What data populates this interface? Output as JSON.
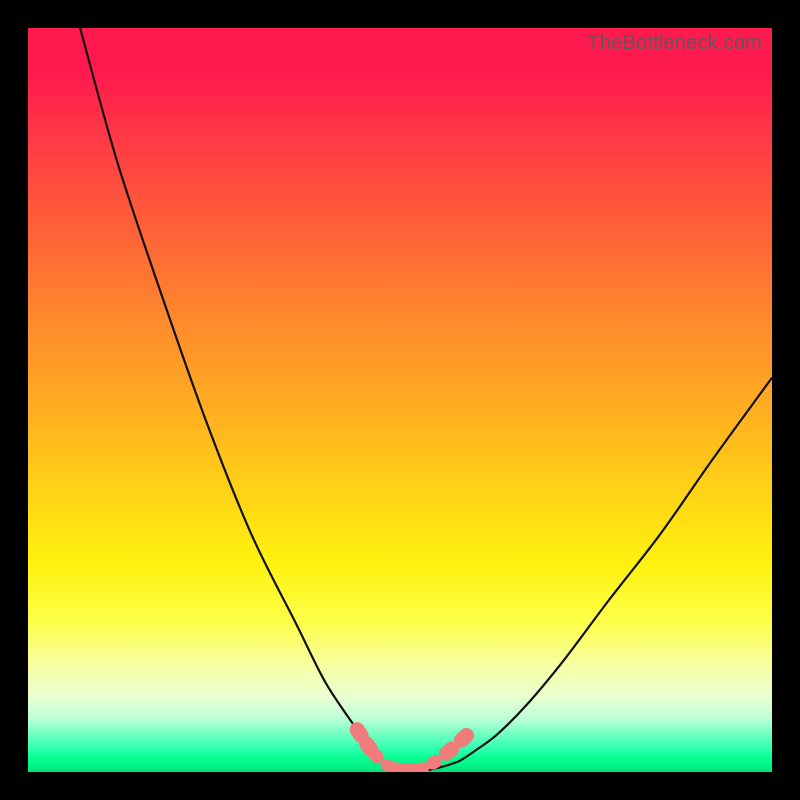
{
  "watermark": "TheBottleneck.com",
  "colors": {
    "background": "#000000",
    "gradient_top": "#ff1a4d",
    "gradient_bottom": "#00e07a",
    "curve": "#111111",
    "markers": "#f17c7c"
  },
  "chart_data": {
    "type": "line",
    "title": "",
    "xlabel": "",
    "ylabel": "",
    "xlim": [
      0,
      100
    ],
    "ylim": [
      0,
      100
    ],
    "series": [
      {
        "name": "left-curve",
        "x": [
          7,
          12,
          18,
          24,
          30,
          36,
          40,
          44,
          46,
          48,
          49.5,
          50.5,
          51.5
        ],
        "y": [
          100,
          82,
          64,
          47,
          32,
          20,
          12,
          6,
          3,
          1.2,
          0.5,
          0.3,
          0.2
        ]
      },
      {
        "name": "right-curve",
        "x": [
          53,
          54,
          56,
          58,
          60,
          63,
          67,
          72,
          78,
          85,
          92,
          100
        ],
        "y": [
          0.2,
          0.3,
          0.8,
          1.5,
          2.8,
          5,
          9,
          15,
          23,
          32,
          42,
          53
        ]
      }
    ],
    "markers": {
      "name": "bottleneck-region",
      "points": [
        {
          "x": 44.5,
          "y": 5.3
        },
        {
          "x": 45.8,
          "y": 3.4
        },
        {
          "x": 46.8,
          "y": 2.2
        },
        {
          "x": 48.3,
          "y": 0.9
        },
        {
          "x": 50.0,
          "y": 0.4
        },
        {
          "x": 51.6,
          "y": 0.3
        },
        {
          "x": 53.0,
          "y": 0.5
        },
        {
          "x": 54.6,
          "y": 1.3
        },
        {
          "x": 56.6,
          "y": 2.8
        },
        {
          "x": 58.6,
          "y": 4.6
        }
      ]
    }
  }
}
